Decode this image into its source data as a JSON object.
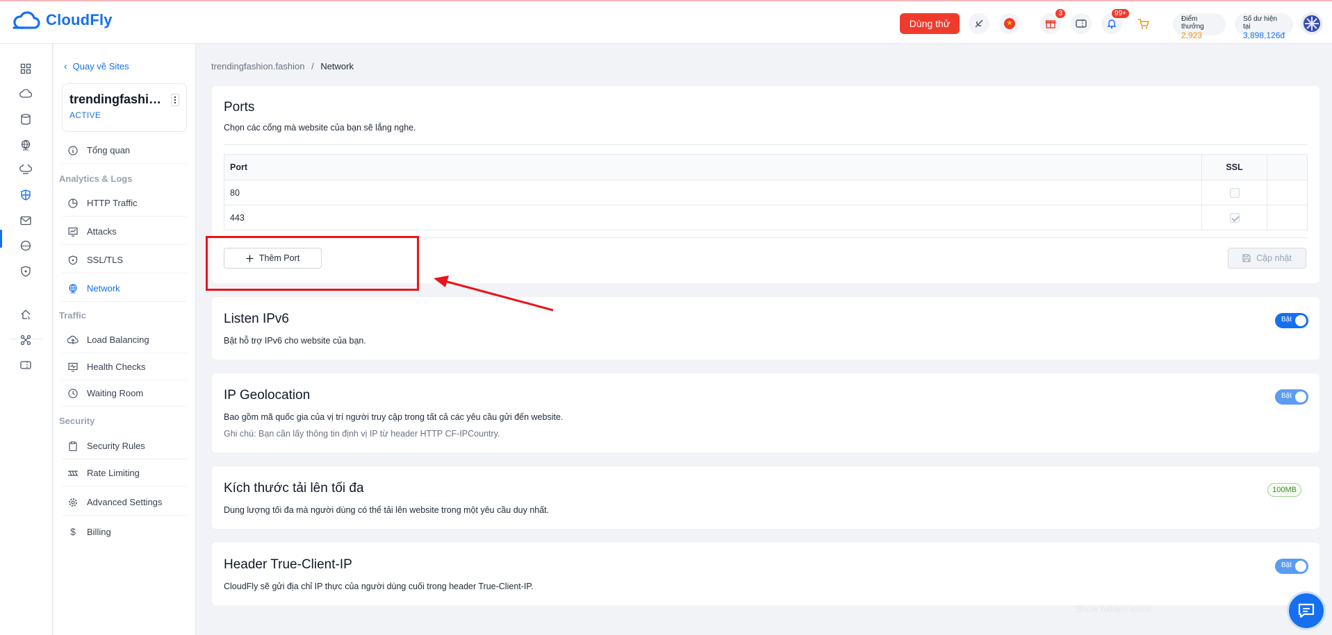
{
  "header": {
    "brand": "CloudFly",
    "trial_label": "Dùng thử",
    "gift_badge": "3",
    "notification_badge": "99+",
    "points_label": "Điểm thưởng",
    "points_value": "2,923",
    "balance_label": "Số dư hiện tại",
    "balance_value": "3,898,126đ"
  },
  "sidebar": {
    "back_label": "Quay về Sites",
    "site_name": "trendingfashion.fashion",
    "site_status": "ACTIVE",
    "overview": "Tổng quan",
    "section_analytics": "Analytics & Logs",
    "http_traffic": "HTTP Traffic",
    "attacks": "Attacks",
    "ssl_tls": "SSL/TLS",
    "network": "Network",
    "section_traffic": "Traffic",
    "load_balancing": "Load Balancing",
    "health_checks": "Health Checks",
    "waiting_room": "Waiting Room",
    "section_security": "Security",
    "security_rules": "Security Rules",
    "rate_limiting": "Rate Limiting",
    "advanced_settings": "Advanced Settings",
    "billing": "Billing"
  },
  "breadcrumb": {
    "site": "trendingfashion.fashion",
    "separator": "/",
    "current": "Network"
  },
  "ports": {
    "title": "Ports",
    "description": "Chọn các cổng mà website của bạn sẽ lắng nghe.",
    "col_port": "Port",
    "col_ssl": "SSL",
    "rows": [
      {
        "port": "80",
        "ssl": false
      },
      {
        "port": "443",
        "ssl": true
      }
    ],
    "add_label": "Thêm Port",
    "update_label": "Cập nhật"
  },
  "ipv6": {
    "title": "Listen IPv6",
    "description": "Bật hỗ trợ IPv6 cho website của bạn.",
    "toggle_label": "Bật",
    "enabled": true
  },
  "geolocation": {
    "title": "IP Geolocation",
    "description": "Bao gồm mã quốc gia của vị trí người truy cập trong tất cả các yêu cầu gửi đến website.",
    "note": "Ghi chú: Bạn cần lấy thông tin định vị IP từ header HTTP CF-IPCountry.",
    "toggle_label": "Bật",
    "enabled": true
  },
  "upload": {
    "title": "Kích thước tải lên tối đa",
    "description": "Dung lượng tối đa mà người dùng có thể tải lên website trong một yêu cầu duy nhất.",
    "value": "100MB"
  },
  "true_client_ip": {
    "title": "Header True-Client-IP",
    "description": "CloudFly sẽ gửi địa chỉ IP thực của người dùng cuối trong header True-Client-IP.",
    "toggle_label": "Bật",
    "enabled": true
  },
  "overlay": {
    "hidden_icons": "Show hidden icons"
  },
  "colors": {
    "primary": "#1570ef",
    "danger": "#ef3b2d",
    "points": "#f79009",
    "annotation": "#e8141b"
  }
}
